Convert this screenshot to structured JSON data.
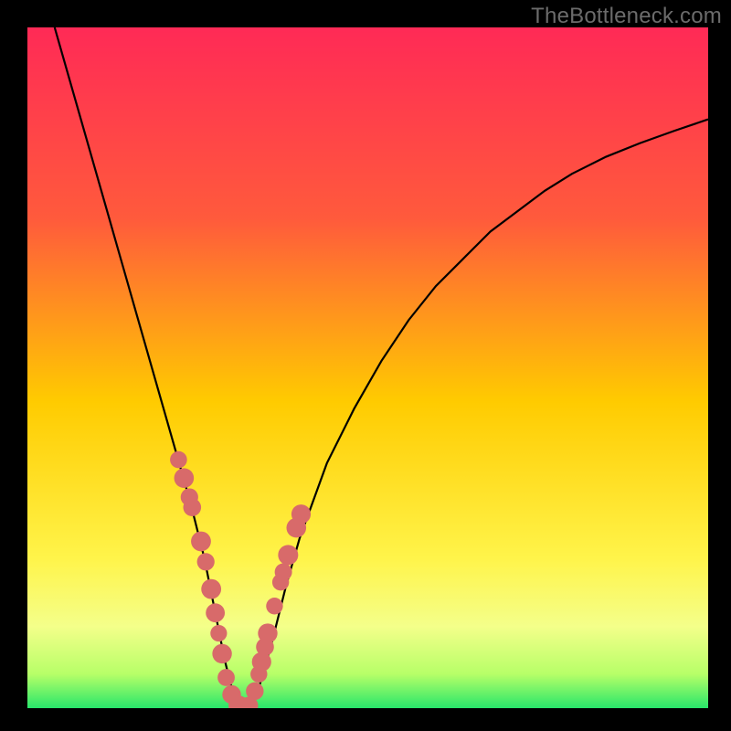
{
  "watermark": "TheBottleneck.com",
  "gradient": {
    "stops": [
      {
        "pct": 0,
        "color": "#ff2a56"
      },
      {
        "pct": 28,
        "color": "#ff5a3c"
      },
      {
        "pct": 55,
        "color": "#ffcb00"
      },
      {
        "pct": 78,
        "color": "#fff44a"
      },
      {
        "pct": 88,
        "color": "#f4ff8a"
      },
      {
        "pct": 95,
        "color": "#b7ff68"
      },
      {
        "pct": 100,
        "color": "#28e66a"
      }
    ]
  },
  "chart_data": {
    "type": "line",
    "title": "",
    "xlabel": "",
    "ylabel": "",
    "xlim": [
      0,
      100
    ],
    "ylim": [
      0,
      100
    ],
    "series": [
      {
        "name": "bottleneck-curve",
        "x": [
          4,
          6,
          8,
          10,
          12,
          14,
          16,
          18,
          20,
          22,
          24,
          26,
          27,
          28,
          29,
          30,
          31,
          32,
          33,
          34,
          36,
          38,
          40,
          44,
          48,
          52,
          56,
          60,
          64,
          68,
          72,
          76,
          80,
          85,
          90,
          95,
          100
        ],
        "values": [
          100,
          93,
          86,
          79,
          72,
          65,
          58,
          51,
          44,
          37,
          30,
          22,
          17,
          12,
          7,
          3,
          0.5,
          0,
          0.5,
          3,
          10,
          18,
          25,
          36,
          44,
          51,
          57,
          62,
          66,
          70,
          73,
          76,
          78.5,
          81,
          83,
          84.8,
          86.5
        ]
      }
    ],
    "markers": {
      "name": "highlight-points",
      "x": [
        22.2,
        23.0,
        23.8,
        24.2,
        25.5,
        26.2,
        27.0,
        27.6,
        28.1,
        28.6,
        29.2,
        30.0,
        31.0,
        32.0,
        32.6,
        33.4,
        34.0,
        34.4,
        34.9,
        35.3,
        36.3,
        37.2,
        37.6,
        38.3,
        39.5,
        40.2
      ],
      "values": [
        36.5,
        33.8,
        31.0,
        29.5,
        24.5,
        21.5,
        17.5,
        14.0,
        11.0,
        8.0,
        4.5,
        2.0,
        0.4,
        0.2,
        0.4,
        2.5,
        5.0,
        6.8,
        9.0,
        11.0,
        15.0,
        18.5,
        20.0,
        22.5,
        26.5,
        28.5
      ]
    }
  }
}
